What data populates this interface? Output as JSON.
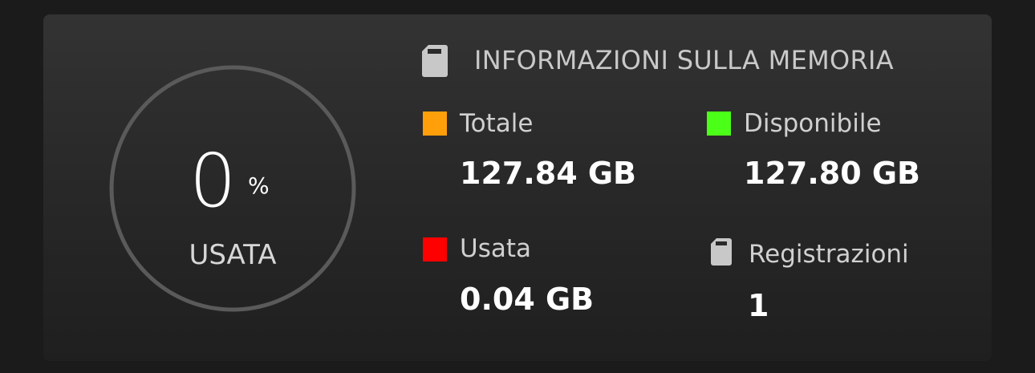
{
  "gauge": {
    "value": "0",
    "unit": "%",
    "label": "USATA",
    "used_fraction": 0.0
  },
  "memory_info": {
    "title": "INFORMAZIONI SULLA MEMORIA",
    "icon": "sd-card-icon",
    "total": {
      "label": "Totale",
      "value": "127.84 GB",
      "color": "#ff9f0a"
    },
    "available": {
      "label": "Disponibile",
      "value": "127.80 GB",
      "color": "#4cff18"
    },
    "used": {
      "label": "Usata",
      "value": "0.04 GB",
      "color": "#ff0000"
    },
    "recordings": {
      "label": "Registrazioni",
      "value": "1",
      "icon": "sd-card-icon"
    }
  },
  "colors": {
    "background": "#1b1b1b",
    "card": "#2a2a2a",
    "ring": "#5a5a5a",
    "icon": "#c8c8c8"
  }
}
